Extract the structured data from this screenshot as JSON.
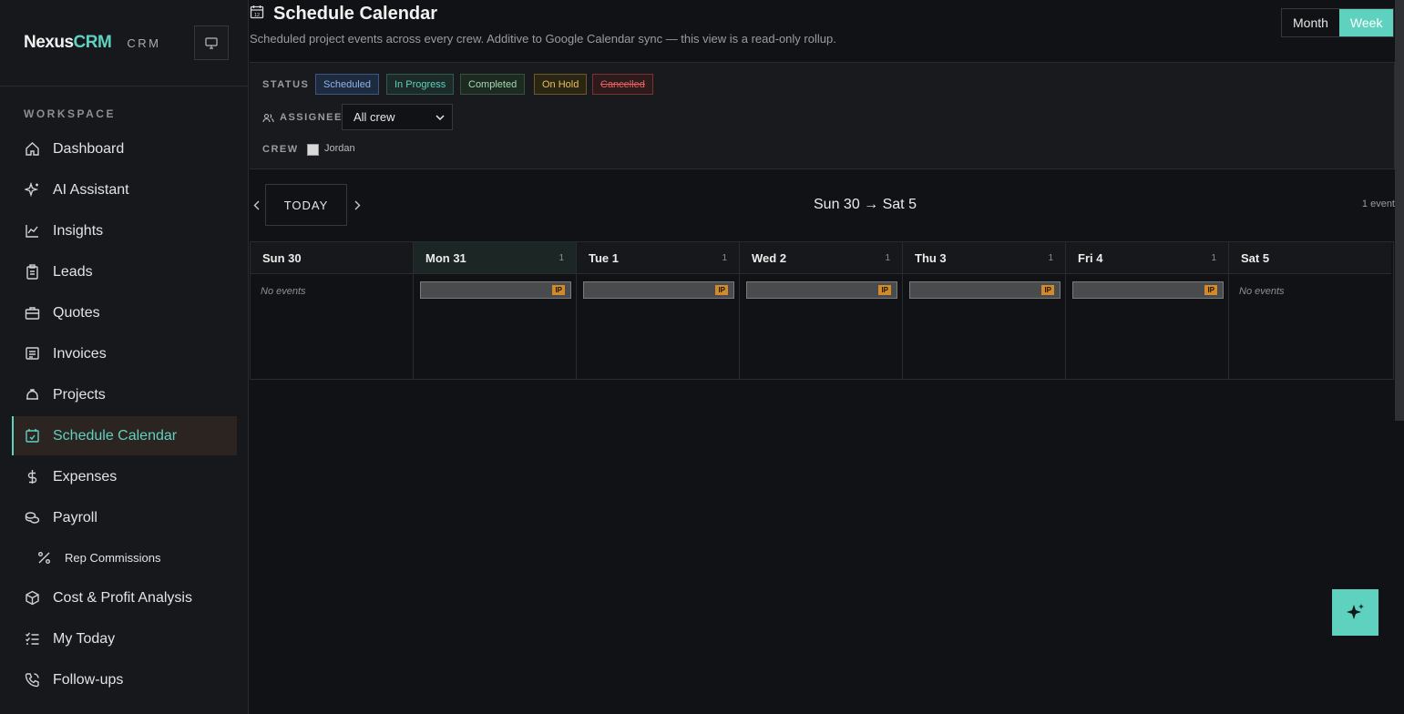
{
  "brand": {
    "name": "Nexus",
    "accent": "CRM",
    "sub": "CRM"
  },
  "sidebar": {
    "section": "WORKSPACE",
    "items": [
      {
        "label": "Dashboard",
        "icon": "home-icon"
      },
      {
        "label": "AI Assistant",
        "icon": "sparkle-icon"
      },
      {
        "label": "Insights",
        "icon": "chart-line-icon"
      },
      {
        "label": "Leads",
        "icon": "clipboard-icon"
      },
      {
        "label": "Quotes",
        "icon": "briefcase-icon"
      },
      {
        "label": "Invoices",
        "icon": "receipt-icon"
      },
      {
        "label": "Projects",
        "icon": "hard-hat-icon"
      },
      {
        "label": "Schedule Calendar",
        "icon": "calendar-check-icon",
        "active": true
      },
      {
        "label": "Expenses",
        "icon": "dollar-icon"
      },
      {
        "label": "Payroll",
        "icon": "coins-icon"
      },
      {
        "label": "Rep Commissions",
        "icon": "percent-icon",
        "sub": true
      },
      {
        "label": "Cost & Profit Analysis",
        "icon": "package-icon"
      },
      {
        "label": "My Today",
        "icon": "checklist-icon"
      },
      {
        "label": "Follow-ups",
        "icon": "phone-icon"
      }
    ]
  },
  "page": {
    "title": "Schedule Calendar",
    "subtitle": "Scheduled project events across every crew. Additive to Google Calendar sync — this view is a read-only rollup.",
    "views": [
      "Month",
      "Week"
    ],
    "active_view": "Week"
  },
  "filters": {
    "status_label": "STATUS",
    "statuses": [
      "Scheduled",
      "In Progress",
      "Completed",
      "On Hold",
      "Cancelled"
    ],
    "assignee_label": "ASSIGNEE",
    "assignee_value": "All crew",
    "crew_label": "CREW",
    "crew_members": [
      "Jordan"
    ]
  },
  "calendar": {
    "today_label": "TODAY",
    "range": "Sun 30 → Sat 5",
    "event_count": "1 event",
    "no_events": "No events",
    "days": [
      {
        "name": "Sun 30",
        "count": "",
        "events": []
      },
      {
        "name": "Mon 31",
        "count": "1",
        "events": [
          "IP"
        ],
        "today": true
      },
      {
        "name": "Tue 1",
        "count": "1",
        "events": [
          "IP"
        ]
      },
      {
        "name": "Wed 2",
        "count": "1",
        "events": [
          "IP"
        ]
      },
      {
        "name": "Thu 3",
        "count": "1",
        "events": [
          "IP"
        ]
      },
      {
        "name": "Fri 4",
        "count": "1",
        "events": [
          "IP"
        ]
      },
      {
        "name": "Sat 5",
        "count": "",
        "events": []
      }
    ]
  },
  "colors": {
    "accent": "#5fd1bf",
    "in_progress_tag": "#d38a2a"
  }
}
